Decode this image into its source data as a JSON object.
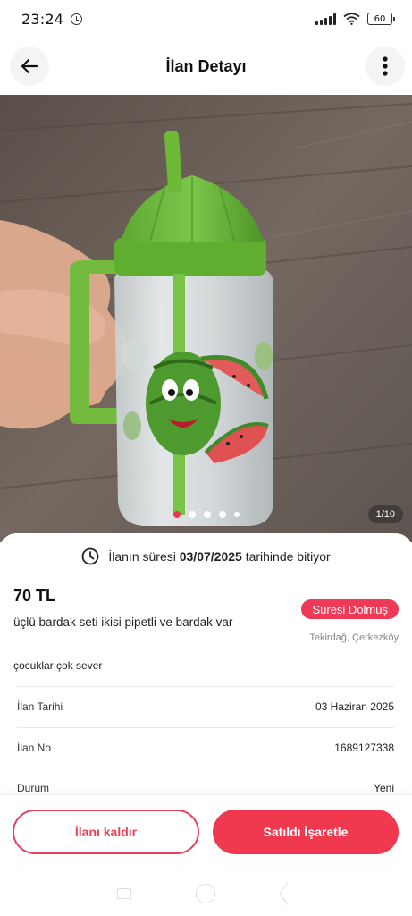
{
  "status": {
    "time": "23:24",
    "battery": "60"
  },
  "header": {
    "title": "İlan Detayı"
  },
  "gallery": {
    "counter": "1/10",
    "dots": 5
  },
  "listing": {
    "expiry_prefix": "İlanın süresi ",
    "expiry_date": "03/07/2025",
    "expiry_suffix": " tarihinde bitiyor",
    "price": "70 TL",
    "status_badge": "Süresi Dolmuş",
    "title": "üçlü bardak seti ikisi pipetli ve bardak var",
    "location": "Tekirdağ, Çerkezköy",
    "description": "çocuklar çok sever"
  },
  "details": [
    {
      "label": "İlan Tarihi",
      "value": "03 Haziran 2025"
    },
    {
      "label": "İlan No",
      "value": "1689127338"
    },
    {
      "label": "Durum",
      "value": "Yeni"
    }
  ],
  "actions": {
    "remove_label": "İlanı kaldır",
    "sold_label": "Satıldı İşaretle"
  },
  "colors": {
    "accent": "#f0384f",
    "badge": "#ee3a57"
  }
}
